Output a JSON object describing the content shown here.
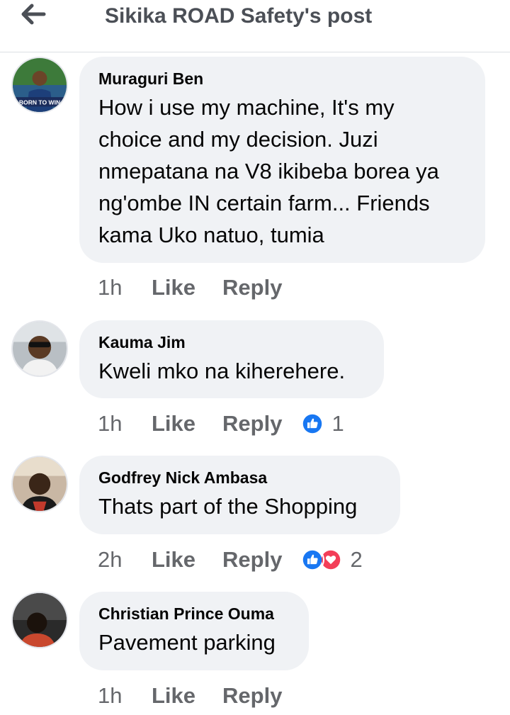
{
  "header": {
    "title": "Sikika ROAD Safety's post",
    "back_icon": "arrow-left-icon"
  },
  "comments": [
    {
      "author": "Muraguri Ben",
      "text": "How i use my machine, It's my\nchoice and my decision. Juzi\nnmepatana na V8 ikibeba borea ya\nng'ombe IN certain farm...  Friends\nkama Uko natuo, tumia",
      "avatar_caption": "BORN TO WIN",
      "time": "1h",
      "like": "Like",
      "reply": "Reply",
      "reactions": [],
      "reaction_count": ""
    },
    {
      "author": "Kauma Jim",
      "text": "Kweli mko na kiherehere.",
      "time": "1h",
      "like": "Like",
      "reply": "Reply",
      "reactions": [
        "like"
      ],
      "reaction_count": "1"
    },
    {
      "author": "Godfrey Nick Ambasa",
      "text": "Thats part of the Shopping",
      "time": "2h",
      "like": "Like",
      "reply": "Reply",
      "reactions": [
        "like",
        "love"
      ],
      "reaction_count": "2"
    },
    {
      "author": "Christian Prince Ouma",
      "text": "Pavement parking",
      "time": "1h",
      "like": "Like",
      "reply": "Reply",
      "reactions": [],
      "reaction_count": ""
    }
  ],
  "colors": {
    "like_blue": "#1877f2",
    "love_red": "#f33e58",
    "bubble": "#f0f2f5",
    "meta_gray": "#65676b"
  }
}
